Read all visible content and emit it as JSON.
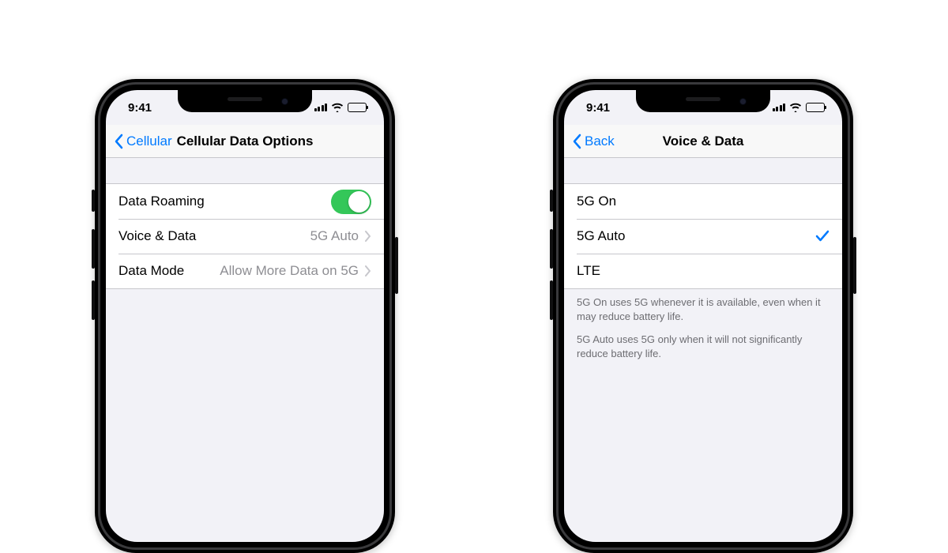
{
  "status": {
    "time": "9:41"
  },
  "left": {
    "back_label": "Cellular",
    "title": "Cellular Data Options",
    "rows": {
      "data_roaming": {
        "label": "Data Roaming",
        "on": true
      },
      "voice_data": {
        "label": "Voice & Data",
        "value": "5G Auto"
      },
      "data_mode": {
        "label": "Data Mode",
        "value": "Allow More Data on 5G"
      }
    }
  },
  "right": {
    "back_label": "Back",
    "title": "Voice & Data",
    "options": [
      {
        "label": "5G On",
        "selected": false
      },
      {
        "label": "5G Auto",
        "selected": true
      },
      {
        "label": "LTE",
        "selected": false
      }
    ],
    "footer": {
      "p1": "5G On uses 5G whenever it is available, even when it may reduce battery life.",
      "p2": "5G Auto uses 5G only when it will not significantly reduce battery life."
    }
  }
}
